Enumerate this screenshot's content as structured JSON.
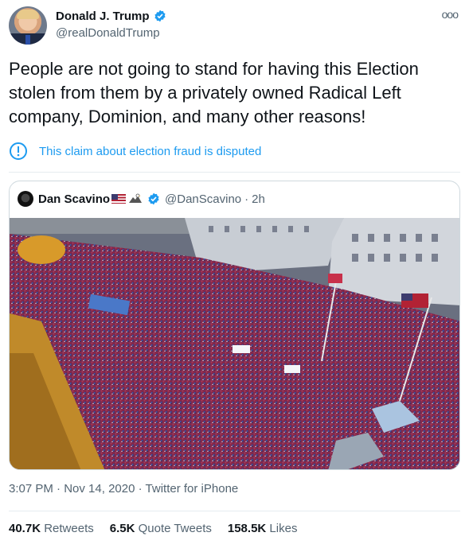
{
  "author": {
    "name": "Donald J. Trump",
    "handle": "@realDonaldTrump",
    "more_label": "ooo"
  },
  "tweet": {
    "text": "People are not going to stand for having this Election stolen from them by a privately owned Radical Left company, Dominion, and many other reasons!"
  },
  "notice": {
    "text": "This claim about election fraud is disputed"
  },
  "quoted": {
    "name": "Dan Scavino",
    "handle": "@DanScavino",
    "separator": "·",
    "time": "2h"
  },
  "meta": {
    "time": "3:07 PM",
    "separator": "·",
    "date": "Nov 14, 2020",
    "separator2": "·",
    "app": "Twitter for iPhone"
  },
  "stats": {
    "retweets": {
      "count": "40.7K",
      "label": "Retweets"
    },
    "quotes": {
      "count": "6.5K",
      "label": "Quote Tweets"
    },
    "likes": {
      "count": "158.5K",
      "label": "Likes"
    }
  },
  "colors": {
    "accent": "#1d9bf0",
    "text": "#0f1419",
    "muted": "#536471",
    "border": "#cfd9de"
  },
  "icons": [
    "verified-badge-icon",
    "more-icon",
    "info-circle-icon",
    "us-flag-icon",
    "eagle-icon"
  ]
}
